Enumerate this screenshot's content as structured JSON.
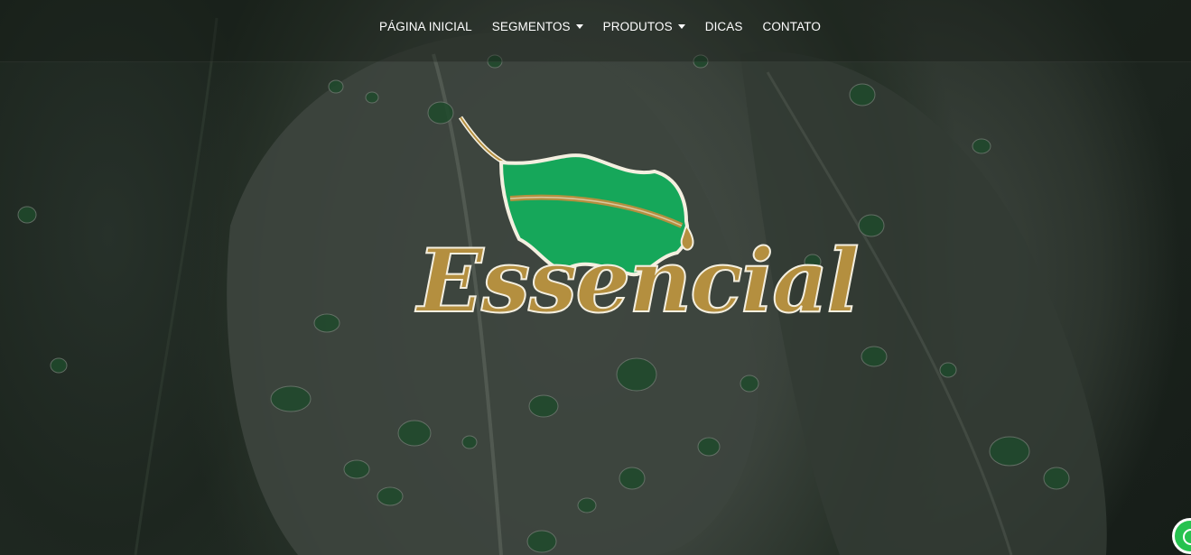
{
  "nav": {
    "items": [
      {
        "label": "PÁGINA INICIAL",
        "has_dropdown": false
      },
      {
        "label": "SEGMENTOS",
        "has_dropdown": true
      },
      {
        "label": "PRODUTOS",
        "has_dropdown": true
      },
      {
        "label": "DICAS",
        "has_dropdown": false
      },
      {
        "label": "CONTATO",
        "has_dropdown": false
      }
    ]
  },
  "logo": {
    "text": "Essencial",
    "icon": "leaf-icon"
  },
  "floating": {
    "icon": "whatsapp-icon"
  },
  "colors": {
    "leaf_green": "#16a75a",
    "gold": "#b48f3f",
    "background": "#1b231d"
  }
}
